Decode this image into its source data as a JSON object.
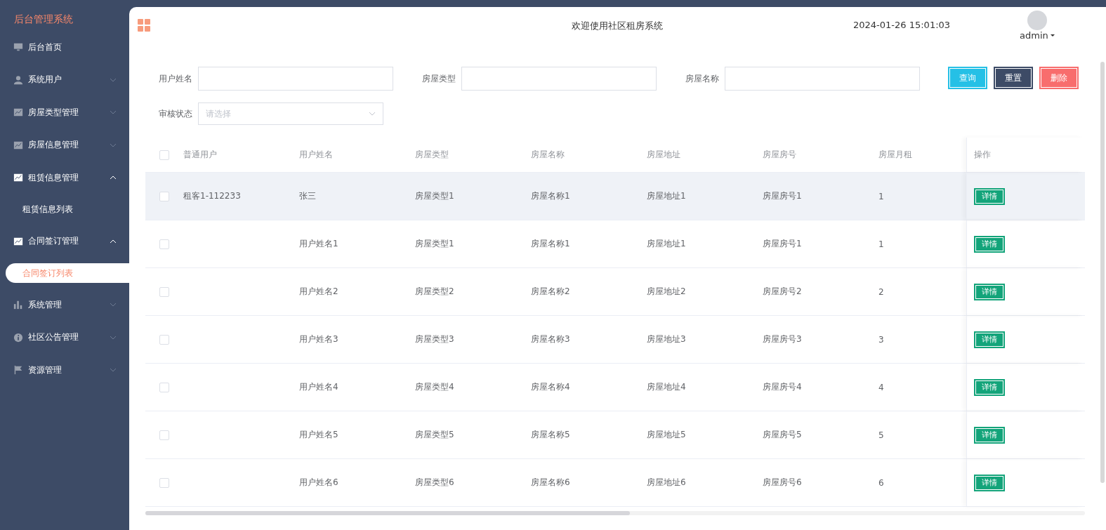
{
  "sidebar": {
    "title": "后台管理系统",
    "items": [
      {
        "label": "后台首页",
        "kind": "monitor"
      },
      {
        "label": "系统用户",
        "kind": "user",
        "expanded": false
      },
      {
        "label": "房屋类型管理",
        "kind": "chart",
        "expanded": false
      },
      {
        "label": "房屋信息管理",
        "kind": "chart",
        "expanded": false
      },
      {
        "label": "租赁信息管理",
        "kind": "chart",
        "expanded": true,
        "children": [
          {
            "label": "租赁信息列表",
            "selected": false
          }
        ]
      },
      {
        "label": "合同签订管理",
        "kind": "chart",
        "expanded": true,
        "children": [
          {
            "label": "合同签订列表",
            "selected": true
          }
        ]
      },
      {
        "label": "系统管理",
        "kind": "bars",
        "expanded": false
      },
      {
        "label": "社区公告管理",
        "kind": "info",
        "expanded": false
      },
      {
        "label": "资源管理",
        "kind": "flag",
        "expanded": false
      }
    ]
  },
  "header": {
    "welcome": "欢迎使用社区租房系统",
    "datetime": "2024-01-26 15:01:03",
    "user": "admin"
  },
  "filters": [
    {
      "label": "用户姓名",
      "kind": "input"
    },
    {
      "label": "房屋类型",
      "kind": "input"
    },
    {
      "label": "房屋名称",
      "kind": "input"
    },
    {
      "label": "审核状态",
      "kind": "select",
      "placeholder": "请选择"
    }
  ],
  "actions": [
    {
      "label": "查询",
      "kind": "query"
    },
    {
      "label": "重置",
      "kind": "reset"
    },
    {
      "label": "删除",
      "kind": "delete"
    }
  ],
  "table": {
    "select_all_checked": false,
    "columns": [
      "普通用户",
      "用户姓名",
      "房屋类型",
      "房屋名称",
      "房屋地址",
      "房屋房号",
      "房屋月租",
      "操作"
    ],
    "rows": [
      {
        "checked": false,
        "hovered": true,
        "cells": [
          "租客1-112233",
          "张三",
          "房屋类型1",
          "房屋名称1",
          "房屋地址1",
          "房屋房号1",
          "1"
        ],
        "action": "详情"
      },
      {
        "checked": false,
        "hovered": false,
        "cells": [
          "",
          "用户姓名1",
          "房屋类型1",
          "房屋名称1",
          "房屋地址1",
          "房屋房号1",
          "1"
        ],
        "action": "详情"
      },
      {
        "checked": false,
        "hovered": false,
        "cells": [
          "",
          "用户姓名2",
          "房屋类型2",
          "房屋名称2",
          "房屋地址2",
          "房屋房号2",
          "2"
        ],
        "action": "详情"
      },
      {
        "checked": false,
        "hovered": false,
        "cells": [
          "",
          "用户姓名3",
          "房屋类型3",
          "房屋名称3",
          "房屋地址3",
          "房屋房号3",
          "3"
        ],
        "action": "详情"
      },
      {
        "checked": false,
        "hovered": false,
        "cells": [
          "",
          "用户姓名4",
          "房屋类型4",
          "房屋名称4",
          "房屋地址4",
          "房屋房号4",
          "4"
        ],
        "action": "详情"
      },
      {
        "checked": false,
        "hovered": false,
        "cells": [
          "",
          "用户姓名5",
          "房屋类型5",
          "房屋名称5",
          "房屋地址5",
          "房屋房号5",
          "5"
        ],
        "action": "详情"
      },
      {
        "checked": false,
        "hovered": false,
        "cells": [
          "",
          "用户姓名6",
          "房屋类型6",
          "房屋名称6",
          "房屋地址6",
          "房屋房号6",
          "6"
        ],
        "action": "详情"
      }
    ]
  }
}
